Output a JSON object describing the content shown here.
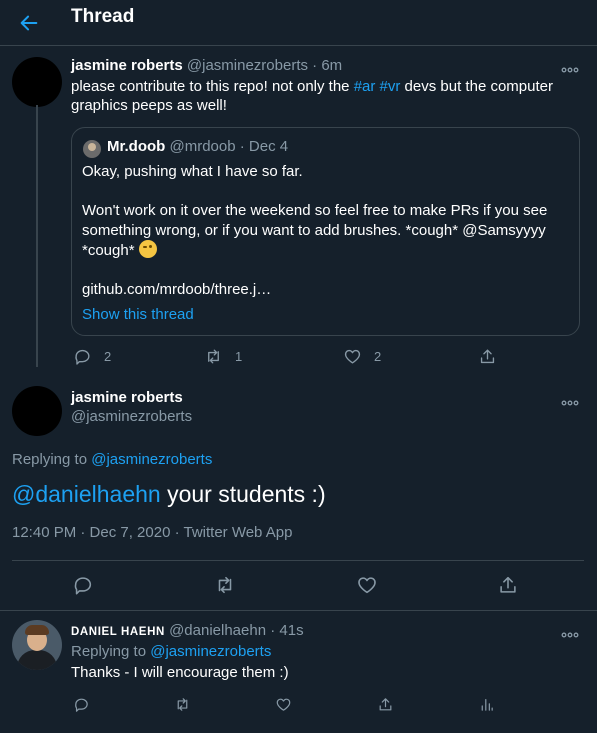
{
  "header": {
    "title": "Thread"
  },
  "tweet1": {
    "name": "jasmine roberts",
    "handle": "@jasminezroberts",
    "time": "· 6m",
    "text_a": "please contribute to this repo! not only the ",
    "hashtag1": "#ar",
    "hashtag2": "#vr",
    "text_b": " devs but the computer graphics peeps as well!",
    "quote": {
      "name": "Mr.doob",
      "handle": "@mrdoob",
      "time": "· Dec 4",
      "line1": "Okay, pushing what I have so far.",
      "line2": "Won't work on it over the weekend so feel free to make PRs if you see something wrong, or if you want to add brushes. *cough* @Samsyyyy *cough*",
      "link": "github.com/mrdoob/three.j…",
      "show_thread": "Show this thread"
    },
    "reply_count": "2",
    "retweet_count": "1",
    "like_count": "2"
  },
  "tweet2": {
    "name": "jasmine roberts",
    "handle": "@jasminezroberts",
    "replying_label": "Replying to ",
    "replying_to": "@jasminezroberts",
    "mention": "@danielhaehn",
    "text": " your students :)",
    "timestamp": "12:40 PM · Dec 7, 2020 · Twitter Web App"
  },
  "tweet3": {
    "name": "DANIEL HAEHN",
    "handle": "@danielhaehn",
    "time": "· 41s",
    "replying_label": "Replying to ",
    "replying_to": "@jasminezroberts",
    "text": "Thanks - I will encourage them :)"
  },
  "colors": {
    "background": "#15202b",
    "accent": "#1da1f2",
    "muted": "#8899a6",
    "border": "#38444d"
  }
}
